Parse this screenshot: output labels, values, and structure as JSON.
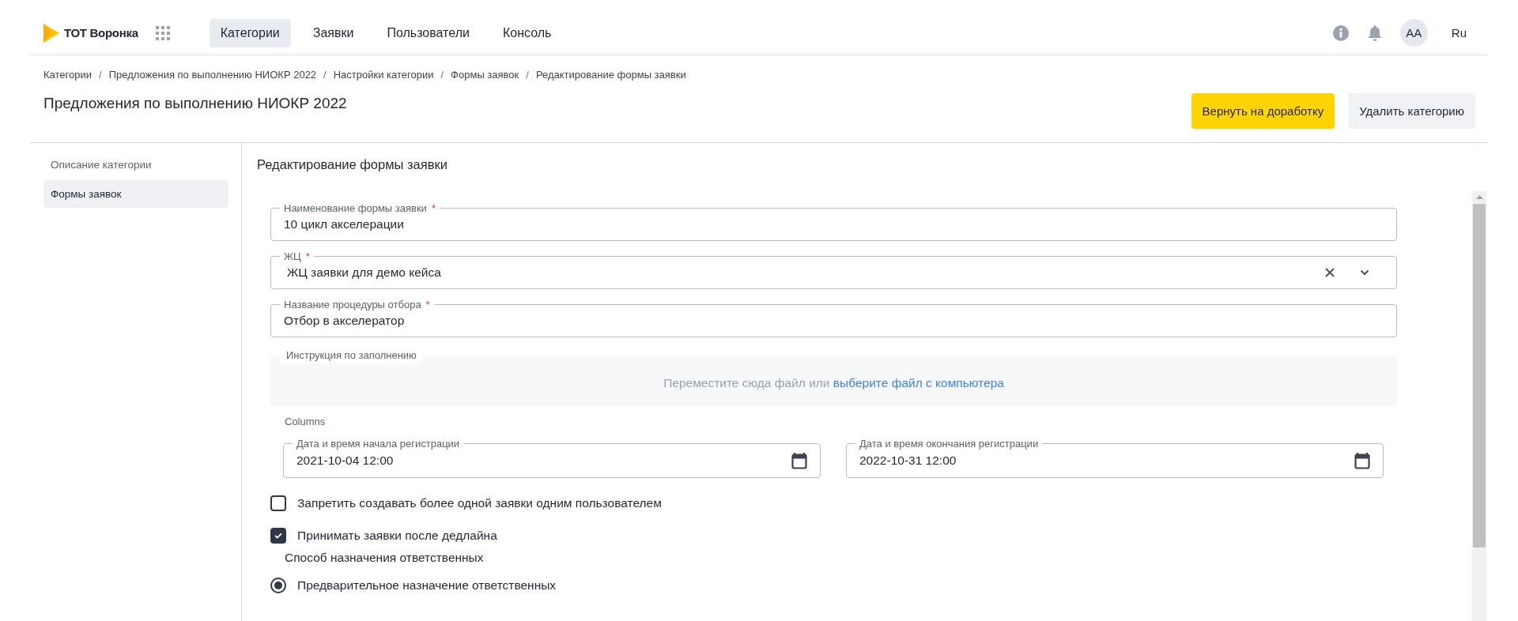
{
  "logo": {
    "text": "ТОТ Воронка"
  },
  "nav": [
    {
      "label": "Категории",
      "selected": true
    },
    {
      "label": "Заявки",
      "selected": false
    },
    {
      "label": "Пользователи",
      "selected": false
    },
    {
      "label": "Консоль",
      "selected": false
    }
  ],
  "header_right": {
    "avatar": "AA",
    "language": "Ru"
  },
  "breadcrumbs": [
    "Категории",
    "Предложения по выполнению НИОКР 2022",
    "Настройки категории",
    "Формы заявок",
    "Редактирование формы заявки"
  ],
  "breadcrumb_separator": "/",
  "page_title": "Предложения по выполнению НИОКР 2022",
  "actions": [
    {
      "label": "Вернуть на доработку",
      "kind": "primary"
    },
    {
      "label": "Удалить категорию",
      "kind": "secondary"
    }
  ],
  "sidebar": {
    "items": [
      {
        "label": "Описание категории",
        "selected": false
      },
      {
        "label": "Формы заявок",
        "selected": true
      }
    ]
  },
  "form": {
    "title": "Редактирование формы заявки",
    "fields": [
      {
        "kind": "text",
        "label": "Наименование формы заявки",
        "required_mark": "*",
        "value": "10 цикл акселерации"
      },
      {
        "kind": "select",
        "label": "ЖЦ",
        "required_mark": "*",
        "value": "ЖЦ заявки для демо кейса"
      },
      {
        "kind": "text",
        "label": "Название процедуры отбора",
        "required_mark": "*",
        "value": "Отбор в акселератор"
      }
    ],
    "upload": {
      "label": "Инструкция по заполнению",
      "text": "Переместите сюда файл или",
      "link": "выберите файл с компьютера"
    },
    "columns_label": "Columns",
    "dates": [
      {
        "label": "Дата и время начала регистрации",
        "value": "2021-10-04 12:00"
      },
      {
        "label": "Дата и время окончания регистрации",
        "value": "2022-10-31 12:00"
      }
    ],
    "checkboxes": [
      {
        "label": "Запретить создавать более одной заявки одним пользователем",
        "checked": false
      },
      {
        "label": "Принимать заявки после дедлайна",
        "checked": true
      }
    ],
    "assignment": {
      "label": "Способ назначения ответственных",
      "options": [
        {
          "label": "Предварительное назначение ответственных",
          "selected": true
        }
      ]
    }
  }
}
